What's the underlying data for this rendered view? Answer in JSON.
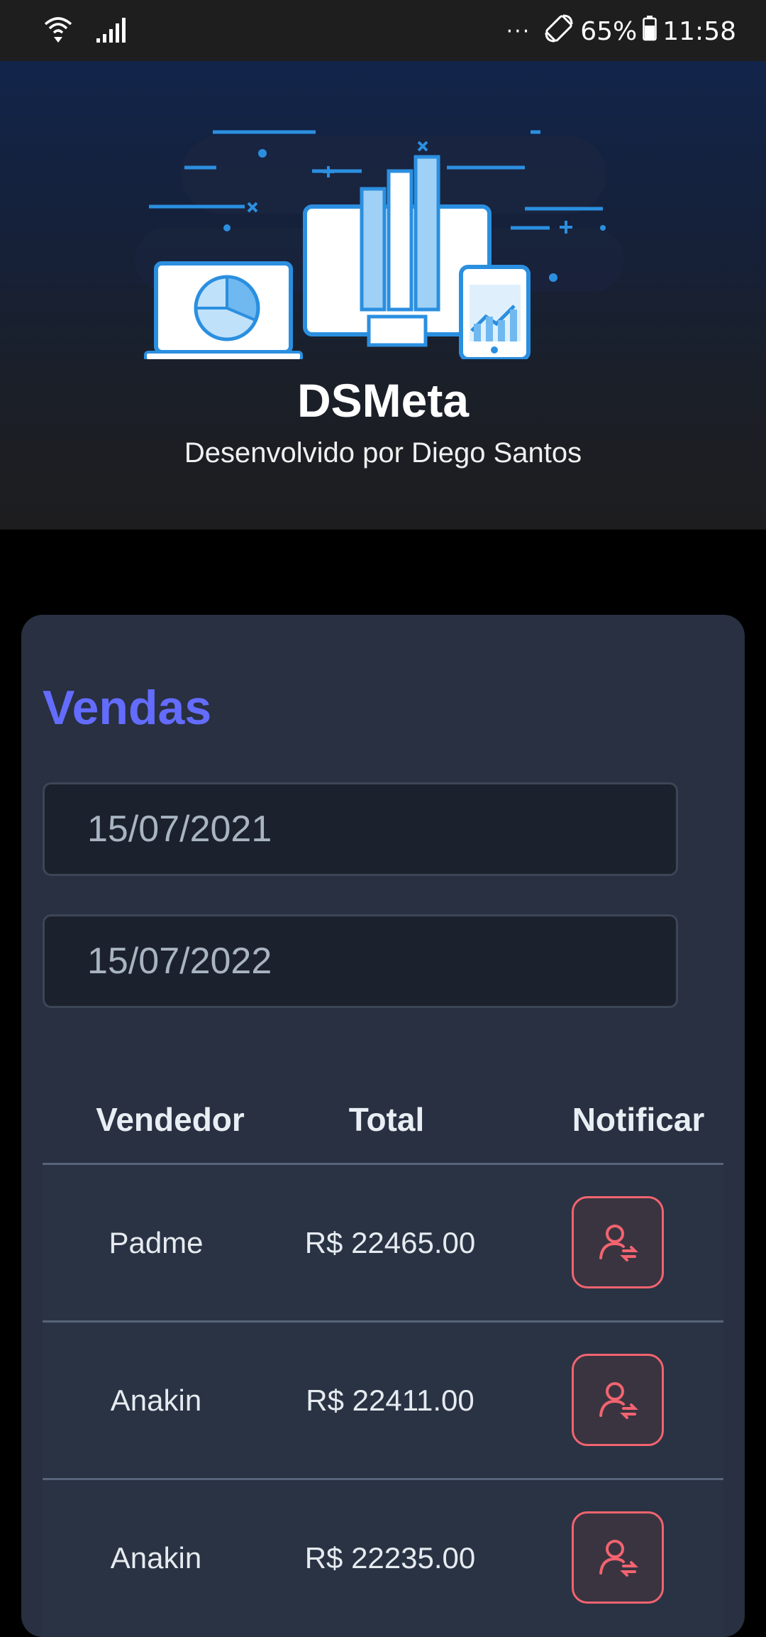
{
  "status_bar": {
    "dots": "···",
    "battery": "65%",
    "time": "11:58"
  },
  "header": {
    "title": "DSMeta",
    "subtitle": "Desenvolvido por Diego Santos"
  },
  "sales": {
    "title": "Vendas",
    "min_date": "15/07/2021",
    "max_date": "15/07/2022",
    "columns": [
      "Vendedor",
      "Total",
      "Notificar"
    ],
    "rows": [
      {
        "seller": "Padme",
        "total": "R$ 22465.00"
      },
      {
        "seller": "Anakin",
        "total": "R$ 22411.00"
      },
      {
        "seller": "Anakin",
        "total": "R$ 22235.00"
      }
    ]
  },
  "colors": {
    "accent": "#646cff",
    "notify": "#f2646f",
    "card": "#283041",
    "input_bg": "#1c222d"
  }
}
